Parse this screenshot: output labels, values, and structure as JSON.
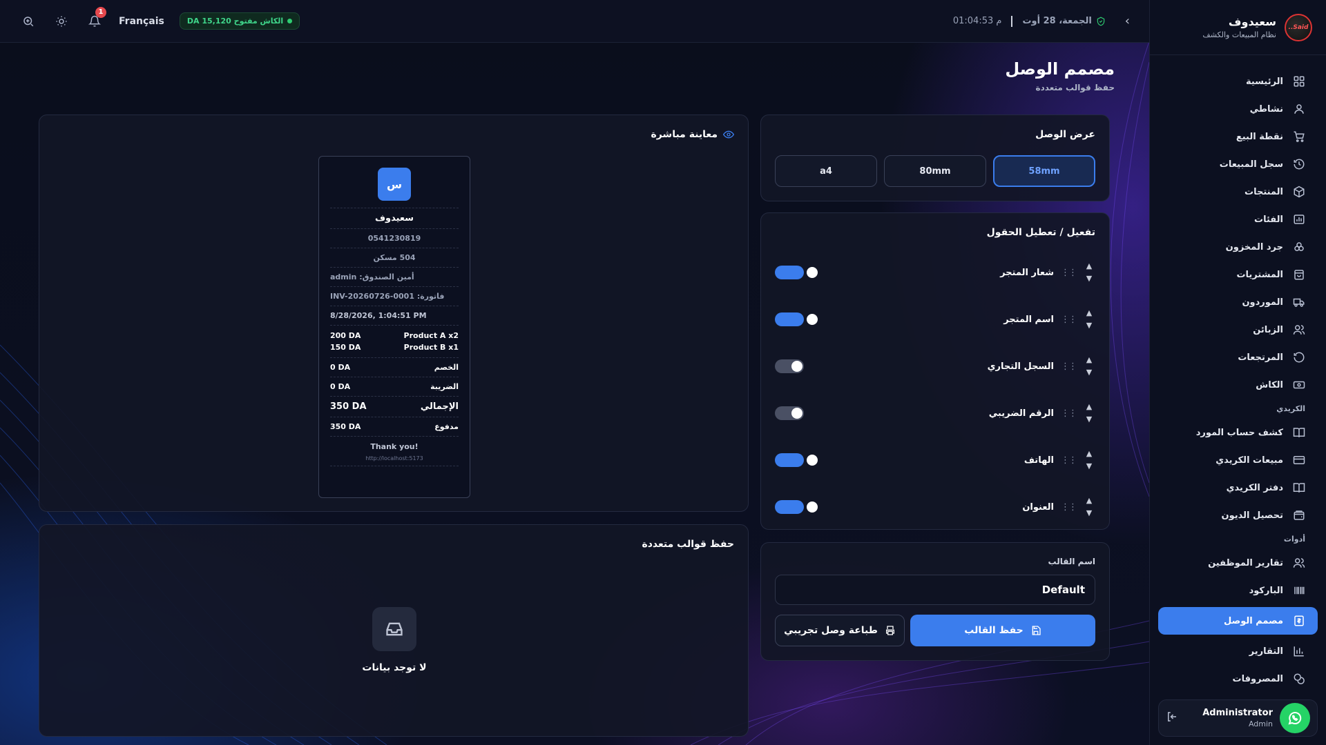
{
  "topbar": {
    "language": "Français",
    "notification_count": "1",
    "cash_status": "الكاش مفتوح 15,120 DA",
    "datetime": "الجمعة، 28 أوت",
    "time": "01:04:53 م"
  },
  "sidebar": {
    "brand_name": "سعيدوف",
    "brand_sub": "نظام المبيعات والكشف",
    "logo_text": "Said..",
    "items": [
      {
        "label": "الرئيسية",
        "icon": "grid-icon"
      },
      {
        "label": "نشاطي",
        "icon": "user-icon"
      },
      {
        "label": "نقطة البيع",
        "icon": "cart-icon"
      },
      {
        "label": "سجل المبيعات",
        "icon": "history-icon"
      },
      {
        "label": "المنتجات",
        "icon": "box-icon"
      },
      {
        "label": "الفئات",
        "icon": "category-icon"
      },
      {
        "label": "جرد المخزون",
        "icon": "boxes-icon"
      },
      {
        "label": "المشتريات",
        "icon": "bag-icon"
      },
      {
        "label": "الموردون",
        "icon": "truck-icon"
      },
      {
        "label": "الزبائن",
        "icon": "users-icon"
      },
      {
        "label": "المرتجعات",
        "icon": "return-icon"
      },
      {
        "label": "الكاش",
        "icon": "cash-icon"
      }
    ],
    "section_credit": "الكريدي",
    "credit_items": [
      {
        "label": "كشف حساب المورد",
        "icon": "book-icon"
      },
      {
        "label": "مبيعات الكريدي",
        "icon": "card-icon"
      },
      {
        "label": "دفتر الكريدي",
        "icon": "book-icon"
      },
      {
        "label": "تحصيل الديون",
        "icon": "wallet-icon"
      }
    ],
    "section_tools": "أدوات",
    "tool_items": [
      {
        "label": "تقارير الموظفين",
        "icon": "users-icon"
      },
      {
        "label": "الباركود",
        "icon": "barcode-icon"
      },
      {
        "label": "مصمم الوصل",
        "icon": "receipt-icon",
        "active": true
      },
      {
        "label": "التقارير",
        "icon": "chart-icon"
      },
      {
        "label": "المصروفات",
        "icon": "coins-icon"
      }
    ],
    "user_name": "Administrator",
    "user_role": "Admin"
  },
  "page": {
    "title": "مصمم الوصل",
    "subtitle": "حفظ قوالب متعددة"
  },
  "receipt_width": {
    "title": "عرض الوصل",
    "options": [
      "58mm",
      "80mm",
      "a4"
    ],
    "selected": "58mm"
  },
  "fields": {
    "title": "تفعيل / تعطيل الحقول",
    "items": [
      {
        "label": "شعار المتجر",
        "enabled": true
      },
      {
        "label": "اسم المتجر",
        "enabled": true
      },
      {
        "label": "السجل التجاري",
        "enabled": false
      },
      {
        "label": "الرقم الضريبي",
        "enabled": false
      },
      {
        "label": "الهاتف",
        "enabled": true
      },
      {
        "label": "العنوان",
        "enabled": true
      }
    ]
  },
  "template": {
    "label": "اسم القالب",
    "value": "Default",
    "save_label": "حفظ القالب",
    "test_label": "طباعة وصل تجريبي"
  },
  "preview": {
    "title": "معاينة مباشرة",
    "logo_letter": "س",
    "store_name": "سعيدوف",
    "phone": "0541230819",
    "address": "504 مسكن",
    "cashier": "أمين الصندوق: admin",
    "invoice": "فاتورة: INV-20260726-0001",
    "datetime": "8/28/2026, 1:04:51 PM",
    "items": [
      {
        "name": "Product A x2",
        "price": "200 DA"
      },
      {
        "name": "Product B x1",
        "price": "150 DA"
      }
    ],
    "discount_label": "الخصم",
    "discount": "0 DA",
    "tax_label": "الضريبة",
    "tax": "0 DA",
    "total_label": "الإجمالي",
    "total": "350 DA",
    "paid_label": "مدفوع",
    "paid": "350 DA",
    "thanks": "Thank you!",
    "url": "http://localhost:5173"
  },
  "templates": {
    "title": "حفظ قوالب متعددة",
    "empty_text": "لا توجد بيانات"
  },
  "colors": {
    "accent": "#3b7ded",
    "success": "#2ecc71",
    "danger": "#e5484d"
  }
}
